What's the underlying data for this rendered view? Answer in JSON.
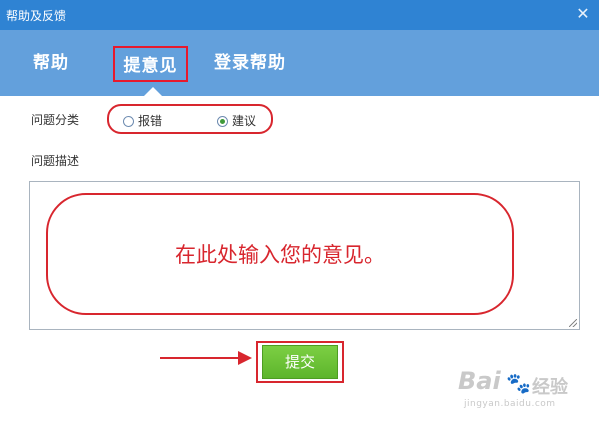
{
  "window": {
    "title": "帮助及反馈",
    "close_glyph": "✕"
  },
  "tabs": [
    {
      "label": "帮助"
    },
    {
      "label": "提意见",
      "active": true
    },
    {
      "label": "登录帮助"
    }
  ],
  "form": {
    "category_label": "问题分类",
    "category_options": [
      {
        "label": "报错",
        "selected": false
      },
      {
        "label": "建议",
        "selected": true
      }
    ],
    "description_label": "问题描述",
    "description_value": "",
    "annotation_text": "在此处输入您的意见。",
    "submit_label": "提交"
  },
  "watermark": {
    "brand_left": "Bai",
    "brand_right": "经验",
    "url": "jingyan.baidu.com"
  },
  "colors": {
    "titlebar": "#2f83d3",
    "tabbar": "#63a0dc",
    "highlight": "#d8262e",
    "submit": "#6cc236"
  }
}
